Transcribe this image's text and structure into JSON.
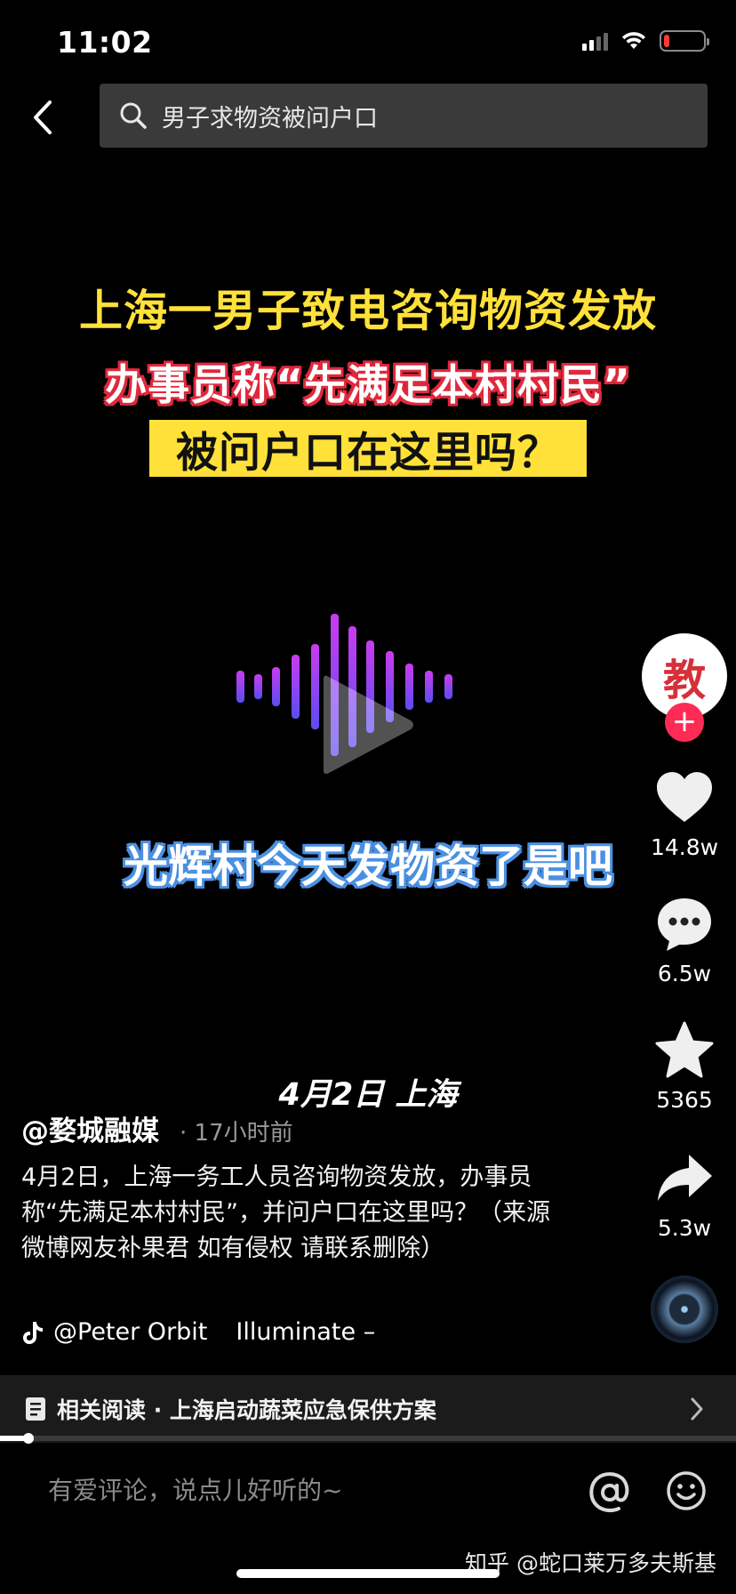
{
  "status_bar": {
    "time": "11:02",
    "battery_level": 0.15,
    "battery_color": "#ff3b30"
  },
  "search": {
    "query": "男子求物资被问户口"
  },
  "video": {
    "headline_line1": "上海一男子致电咨询物资发放",
    "headline_line2": "办事员称“先满足本村村民”",
    "headline_line3": "被问户口在这里吗？",
    "subtitle": "光辉村今天发物资了是吧",
    "date_place": "4月2日 上海",
    "accent_yellow": "#ffe13a",
    "accent_red": "#e0283c",
    "accent_blue": "#4a90e2"
  },
  "creator": {
    "avatar_text": "教"
  },
  "actions": {
    "likes": "14.8w",
    "comments": "6.5w",
    "favorites": "5365",
    "shares": "5.3w"
  },
  "post": {
    "author": "@婺城融媒",
    "time": "· 17小时前",
    "description": "4月2日，上海一务工人员咨询物资发放，办事员称“先满足本村村民”，并问户口在这里吗？（来源微博网友补果君 如有侵权 请联系删除）",
    "music_author": "@Peter Orbit",
    "music_track": "Illuminate –"
  },
  "related": {
    "text": "相关阅读 · 上海启动蔬菜应急保供方案"
  },
  "playback": {
    "progress": 0.035
  },
  "comment_bar": {
    "placeholder": "有爱评论，说点儿好听的~"
  },
  "watermark": "知乎 @蛇口莱万多夫斯基"
}
